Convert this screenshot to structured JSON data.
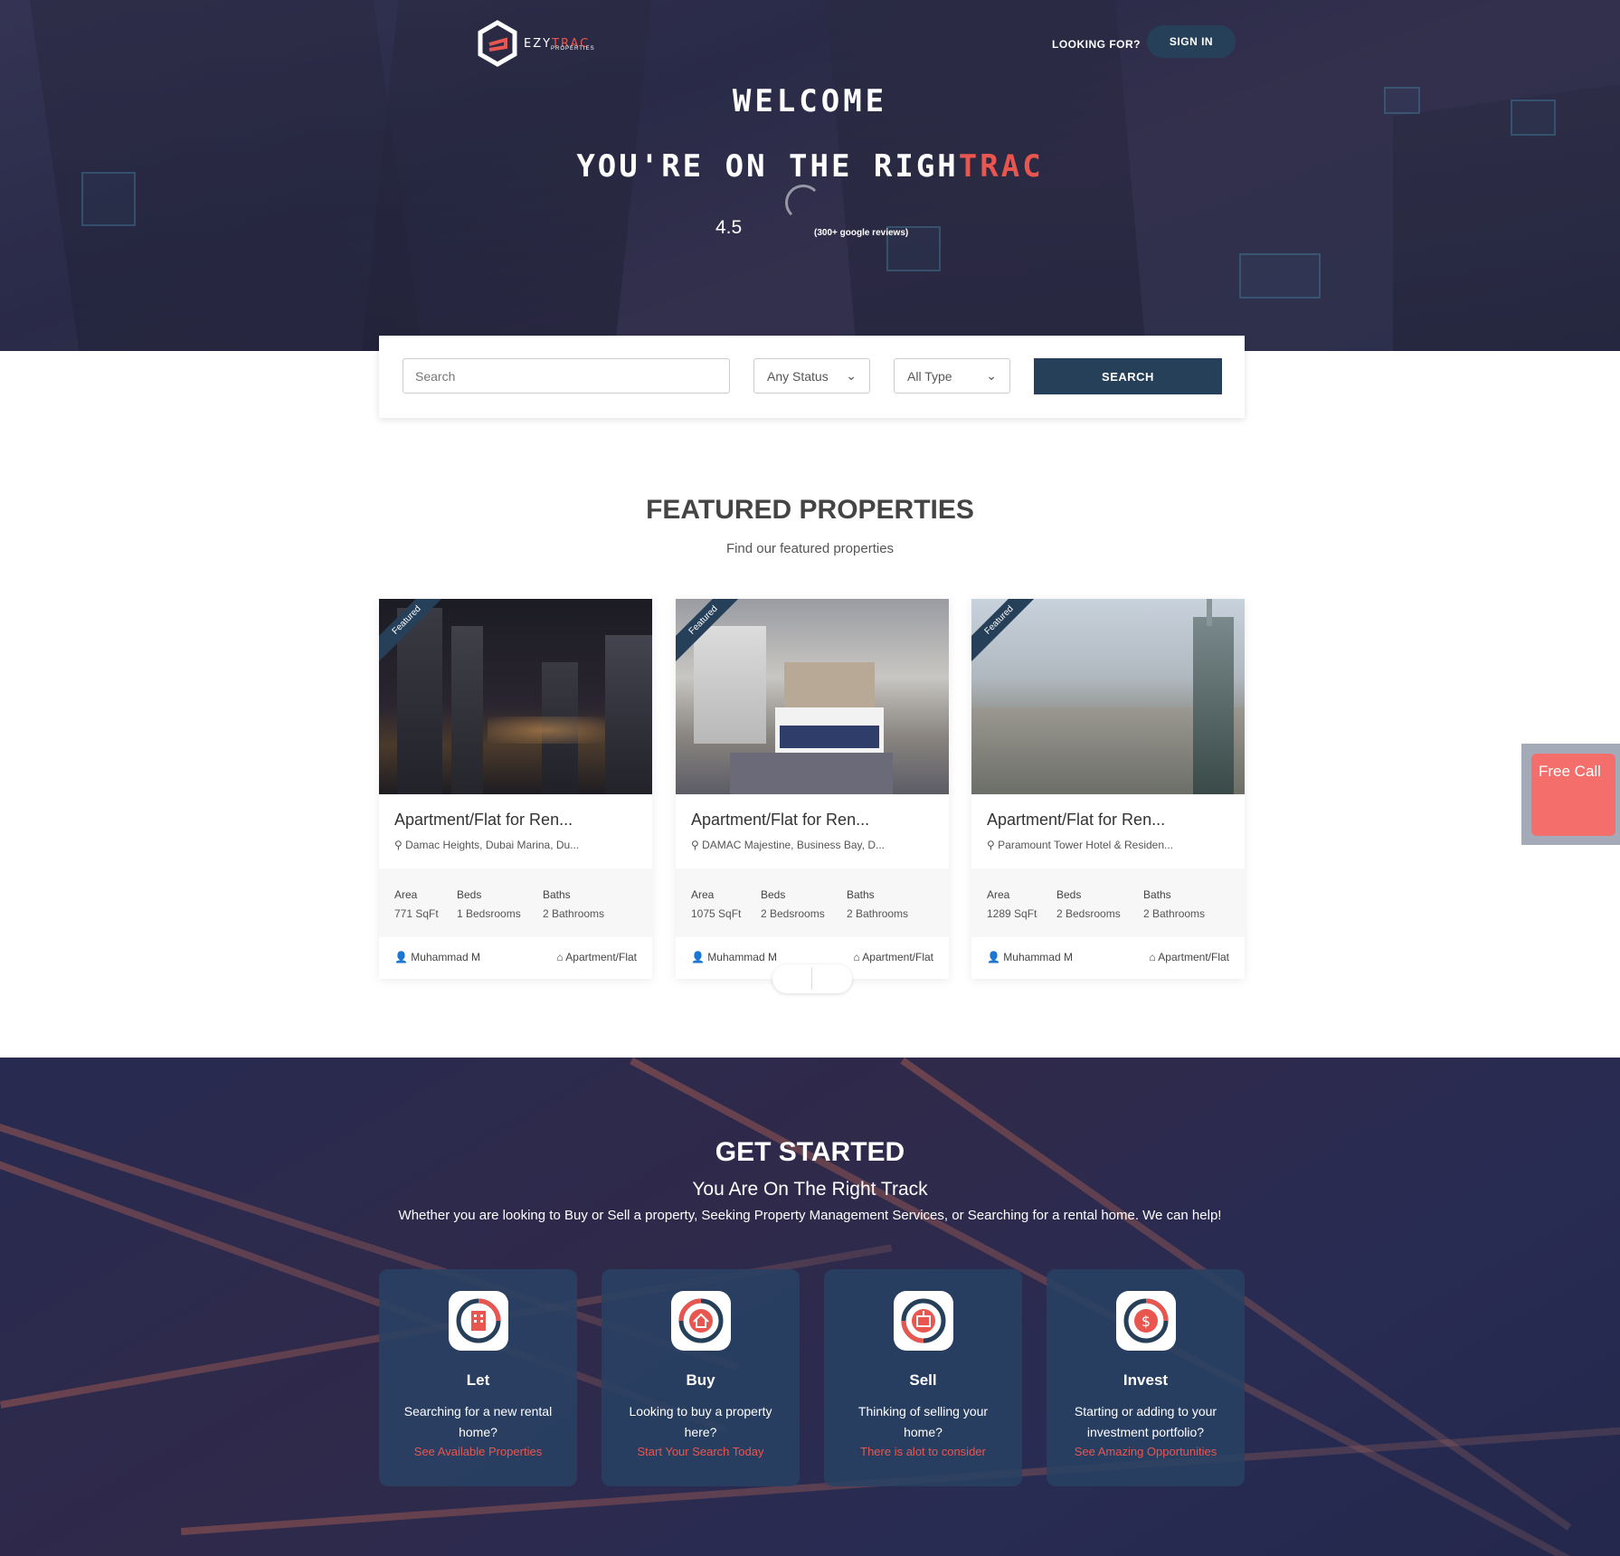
{
  "header": {
    "logo_text_a": "EZY",
    "logo_text_b": "TRAC",
    "logo_sub": "PROPERTIES",
    "looking_for": "LOOKING FOR?",
    "sign_in": "SIGN IN"
  },
  "hero": {
    "welcome": "WELCOME",
    "tagline_a": "YOU'RE ON THE RIGH",
    "tagline_b": "TRAC",
    "rating": "4.5",
    "reviews": "(300+ google reviews)"
  },
  "search": {
    "placeholder": "Search",
    "status": "Any Status",
    "type": "All Type",
    "button": "SEARCH"
  },
  "featured": {
    "title": "FEATURED PROPERTIES",
    "subtitle": "Find our featured properties",
    "ribbon": "Featured",
    "stat_labels": {
      "area": "Area",
      "beds": "Beds",
      "baths": "Baths"
    },
    "cards": [
      {
        "title": "Apartment/Flat for Ren...",
        "address": "Damac Heights, Dubai Marina, Du...",
        "area": "771 SqFt",
        "beds": "1 Bedsrooms",
        "baths": "2 Bathrooms",
        "agent": "Muhammad M",
        "type": "Apartment/Flat"
      },
      {
        "title": "Apartment/Flat for Ren...",
        "address": "DAMAC Majestine, Business Bay, D...",
        "area": "1075 SqFt",
        "beds": "2 Bedsrooms",
        "baths": "2 Bathrooms",
        "agent": "Muhammad M",
        "type": "Apartment/Flat"
      },
      {
        "title": "Apartment/Flat for Ren...",
        "address": "Paramount Tower Hotel & Residen...",
        "area": "1289 SqFt",
        "beds": "2 Bedsrooms",
        "baths": "2 Bathrooms",
        "agent": "Muhammad M",
        "type": "Apartment/Flat"
      }
    ]
  },
  "free_call": "Free Call",
  "get_started": {
    "title": "GET STARTED",
    "subtitle": "You Are On The Right Track",
    "description": "Whether you are looking to Buy or Sell a property, Seeking Property Management Services, or Searching for a rental home. We can help!",
    "services": [
      {
        "name": "Let",
        "desc": "Searching for a new rental home?",
        "link": "See Available Properties",
        "icon": "building-icon"
      },
      {
        "name": "Buy",
        "desc": "Looking to buy a property here?",
        "link": "Start Your Search Today",
        "icon": "house-icon"
      },
      {
        "name": "Sell",
        "desc": "Thinking of selling your home?",
        "link": "There is alot to consider",
        "icon": "sale-sign-icon"
      },
      {
        "name": "Invest",
        "desc": "Starting or adding to your investment portfolio?",
        "link": "See Amazing Opportunities",
        "icon": "dollar-icon"
      }
    ]
  },
  "colors": {
    "accent": "#e8564f",
    "navy": "#27405a",
    "freecall": "#f46f6c"
  }
}
